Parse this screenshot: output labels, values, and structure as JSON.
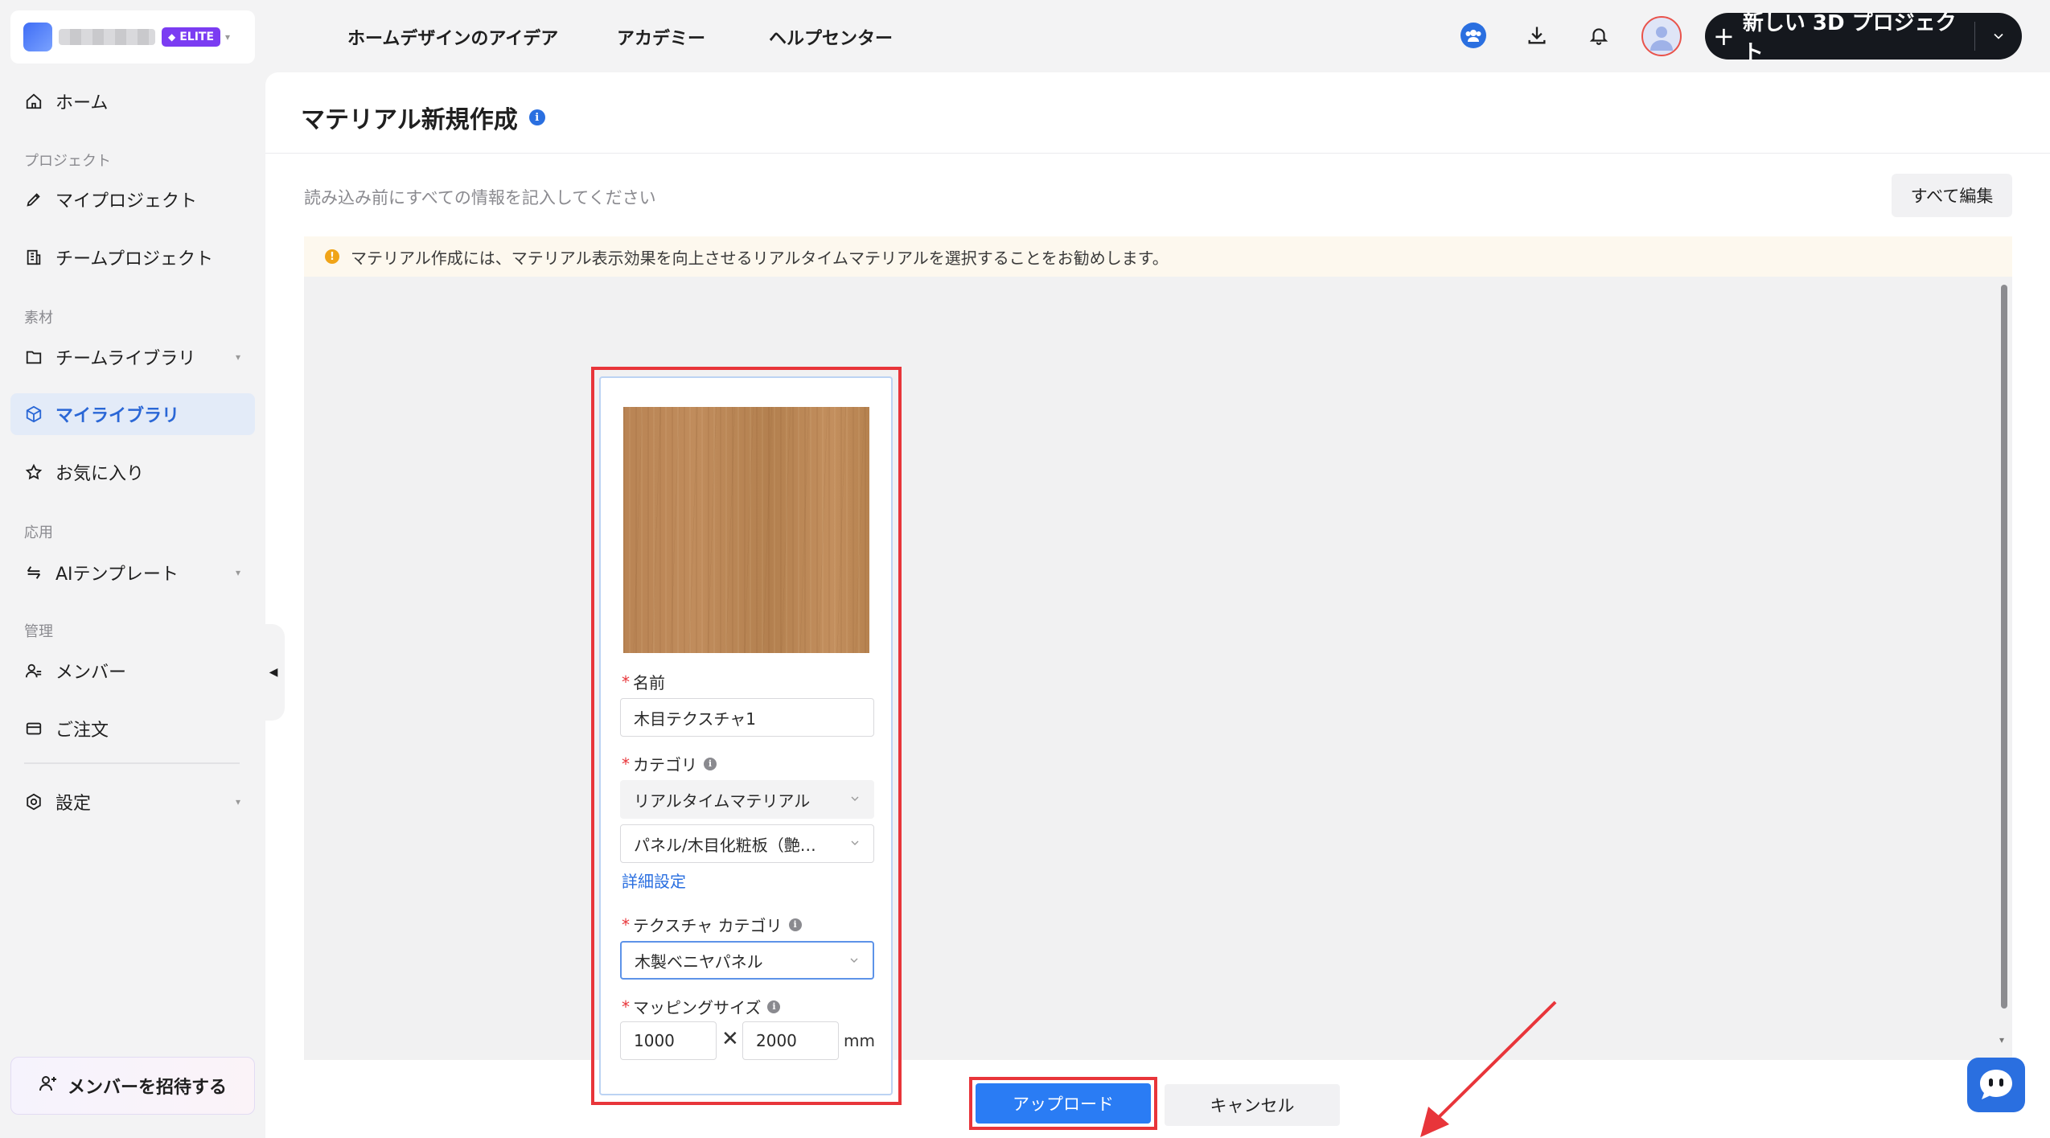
{
  "workspace": {
    "badge": "ELITE"
  },
  "topnav": {
    "links": [
      "ホームデザインのアイデア",
      "アカデミー",
      "ヘルプセンター"
    ],
    "new_project_label": "新しい 3D プロジェクト"
  },
  "sidebar": {
    "home": "ホーム",
    "section_project": "プロジェクト",
    "my_projects": "マイプロジェクト",
    "team_projects": "チームプロジェクト",
    "section_material": "素材",
    "team_library": "チームライブラリ",
    "my_library": "マイライブラリ",
    "favorites": "お気に入り",
    "section_apply": "応用",
    "ai_templates": "AIテンプレート",
    "section_manage": "管理",
    "members": "メンバー",
    "orders": "ご注文",
    "settings": "設定",
    "invite": "メンバーを招待する"
  },
  "page": {
    "title": "マテリアル新規作成",
    "subtitle": "読み込み前にすべての情報を記入してください",
    "edit_all": "すべて編集",
    "notice": "マテリアル作成には、マテリアル表示効果を向上させるリアルタイムマテリアルを選択することをお勧めします。"
  },
  "form": {
    "name_label": "名前",
    "name_value": "木目テクスチャ1",
    "category_label": "カテゴリ",
    "category_value": "リアルタイムマテリアル",
    "subcategory_value": "パネル/木目化粧板（艶…",
    "detail_link": "詳細設定",
    "texture_category_label": "テクスチャ カテゴリ",
    "texture_category_value": "木製ベニヤパネル",
    "mapping_label": "マッピングサイズ",
    "width_value": "1000",
    "height_value": "2000",
    "times": "✕",
    "unit": "mm"
  },
  "actions": {
    "upload": "アップロード",
    "cancel": "キャンセル"
  },
  "colors": {
    "accent": "#2a7cf4",
    "highlight": "#e8353a",
    "active_nav_bg": "#e3ebf8",
    "elite": "#7b3cf2"
  }
}
